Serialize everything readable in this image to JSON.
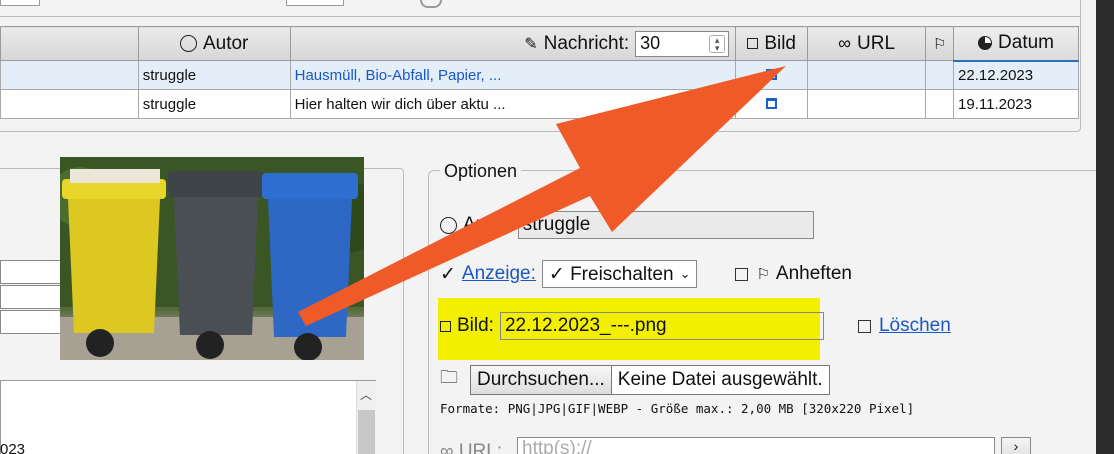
{
  "table": {
    "headers": {
      "author": "Autor",
      "message": "Nachricht:",
      "message_count": "30",
      "image": "Bild",
      "url": "URL",
      "date": "Datum"
    },
    "rows": [
      {
        "author": "struggle",
        "message": "Hausmüll, Bio-Abfall, Papier, ...",
        "date": "22.12.2023"
      },
      {
        "author": "struggle",
        "message": "Hier halten wir dich über aktu ...",
        "date": "19.11.2023"
      }
    ]
  },
  "left": {
    "text_fragment": "023"
  },
  "options": {
    "legend": "Optionen",
    "author_label": "Autor:",
    "author_value": "struggle",
    "display_label": "Anzeige:",
    "display_value": "✓ Freischalten",
    "pin_label": "Anheften",
    "image_label": "Bild:",
    "image_value": "22.12.2023_---.png",
    "delete_label": "Löschen",
    "browse_label": "Durchsuchen...",
    "no_file": "Keine Datei ausgewählt.",
    "formats": "Formate: PNG|JPG|GIF|WEBP - Größe max.: 2,00 MB [320x220 Pixel]",
    "url_label": "URL:",
    "url_placeholder": "http(s)://"
  },
  "colors": {
    "highlight": "#f2f000",
    "arrow": "#f05a28",
    "link": "#1a57c6"
  }
}
